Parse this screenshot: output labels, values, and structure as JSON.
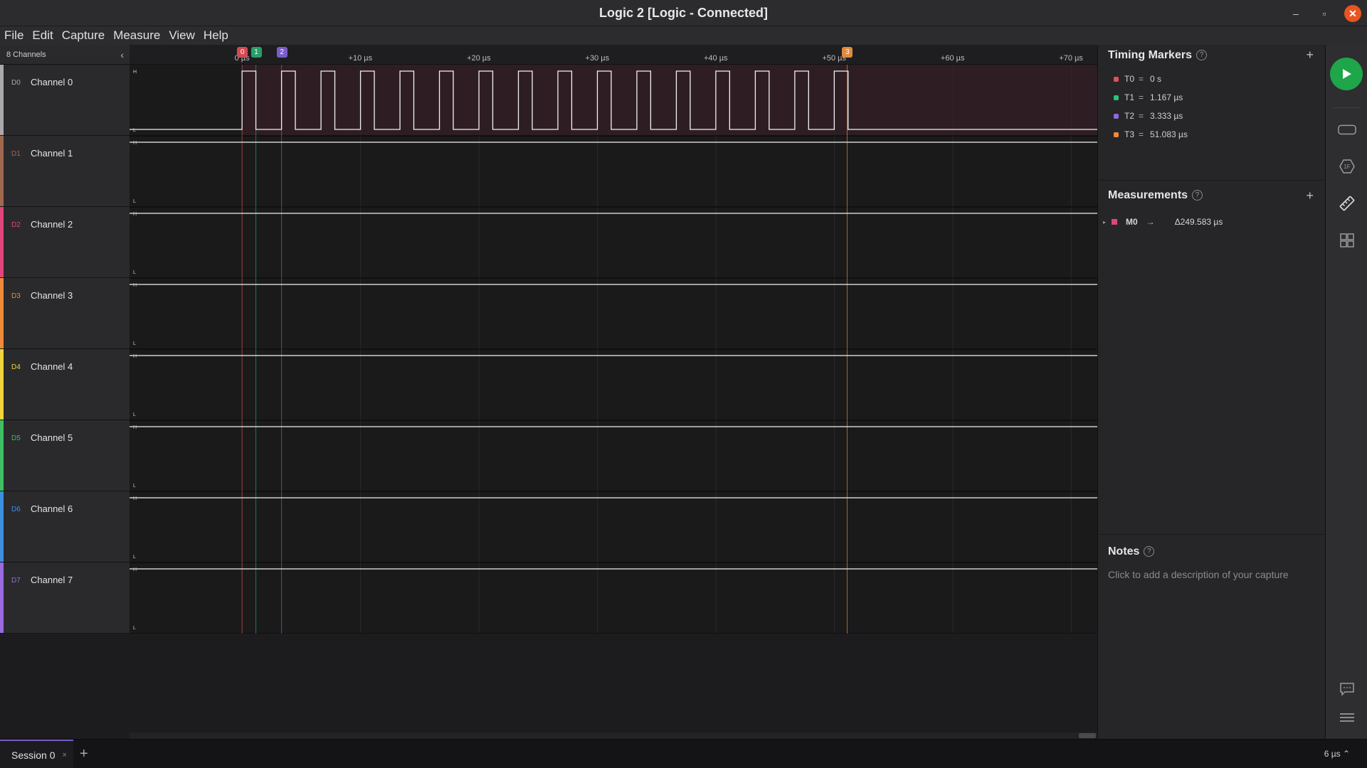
{
  "window": {
    "title": "Logic 2 [Logic - Connected]",
    "minimize": "–",
    "maximize": "▫",
    "close": "✕"
  },
  "menu": [
    "File",
    "Edit",
    "Capture",
    "Measure",
    "View",
    "Help"
  ],
  "channels_header": {
    "count_label": "8 Channels",
    "collapse_icon": "‹"
  },
  "channels": [
    {
      "id": "D0",
      "name": "Channel 0",
      "color": "#a9a9a9"
    },
    {
      "id": "D1",
      "name": "Channel 1",
      "color": "#a0694f"
    },
    {
      "id": "D2",
      "name": "Channel 2",
      "color": "#e0457b"
    },
    {
      "id": "D3",
      "name": "Channel 3",
      "color": "#ee8a3a"
    },
    {
      "id": "D4",
      "name": "Channel 4",
      "color": "#f0d43c"
    },
    {
      "id": "D5",
      "name": "Channel 5",
      "color": "#3fbf63"
    },
    {
      "id": "D6",
      "name": "Channel 6",
      "color": "#3d8fe0"
    },
    {
      "id": "D7",
      "name": "Channel 7",
      "color": "#9a6ae0"
    }
  ],
  "level_labels": {
    "high": "H",
    "low": "L"
  },
  "ruler": {
    "ticks": [
      {
        "label": "0 µs",
        "t": 0
      },
      {
        "label": "+10 µs",
        "t": 10
      },
      {
        "label": "+20 µs",
        "t": 20
      },
      {
        "label": "+30 µs",
        "t": 30
      },
      {
        "label": "+40 µs",
        "t": 40
      },
      {
        "label": "+50 µs",
        "t": 50
      },
      {
        "label": "+60 µs",
        "t": 60
      },
      {
        "label": "+70 µs",
        "t": 70
      }
    ],
    "time_start_us": -9.5,
    "time_end_us": 72.2
  },
  "marker_flags": [
    {
      "label": "0",
      "t": 0,
      "color": "#d24b52"
    },
    {
      "label": "1",
      "t": 1.167,
      "color": "#2a9d6a"
    },
    {
      "label": "2",
      "t": 3.333,
      "color": "#7a5cc9"
    },
    {
      "label": "3",
      "t": 51.083,
      "color": "#e08a3c"
    }
  ],
  "channel0_signal": {
    "period_us": 3.333,
    "high_us": 1.167,
    "pulses": 16,
    "start_us": 0
  },
  "measurement_region": {
    "color": "#e0457b"
  },
  "timing_markers": {
    "title": "Timing Markers",
    "help": "?",
    "add": "+",
    "items": [
      {
        "name": "T0",
        "eq": "=",
        "value": "0 s",
        "color": "#e05252"
      },
      {
        "name": "T1",
        "eq": "=",
        "value": "1.167 µs",
        "color": "#2fbf7a"
      },
      {
        "name": "T2",
        "eq": "=",
        "value": "3.333 µs",
        "color": "#8e6ae0"
      },
      {
        "name": "T3",
        "eq": "=",
        "value": "51.083 µs",
        "color": "#ee8a3a"
      }
    ]
  },
  "measurements": {
    "title": "Measurements",
    "help": "?",
    "add": "+",
    "items": [
      {
        "name": "M0",
        "arrow": "→",
        "value": "Δ249.583 µs",
        "color": "#e0457b"
      }
    ]
  },
  "notes": {
    "title": "Notes",
    "help": "?",
    "placeholder": "Click to add a description of your capture"
  },
  "toolbar": [
    "play-icon",
    "device-icon",
    "analyzer-icon",
    "ruler-icon",
    "extensions-icon",
    "chat-icon",
    "menu-icon"
  ],
  "bottom": {
    "session": "Session 0",
    "close": "×",
    "add": "+",
    "zoom": "6 µs ⌃"
  }
}
